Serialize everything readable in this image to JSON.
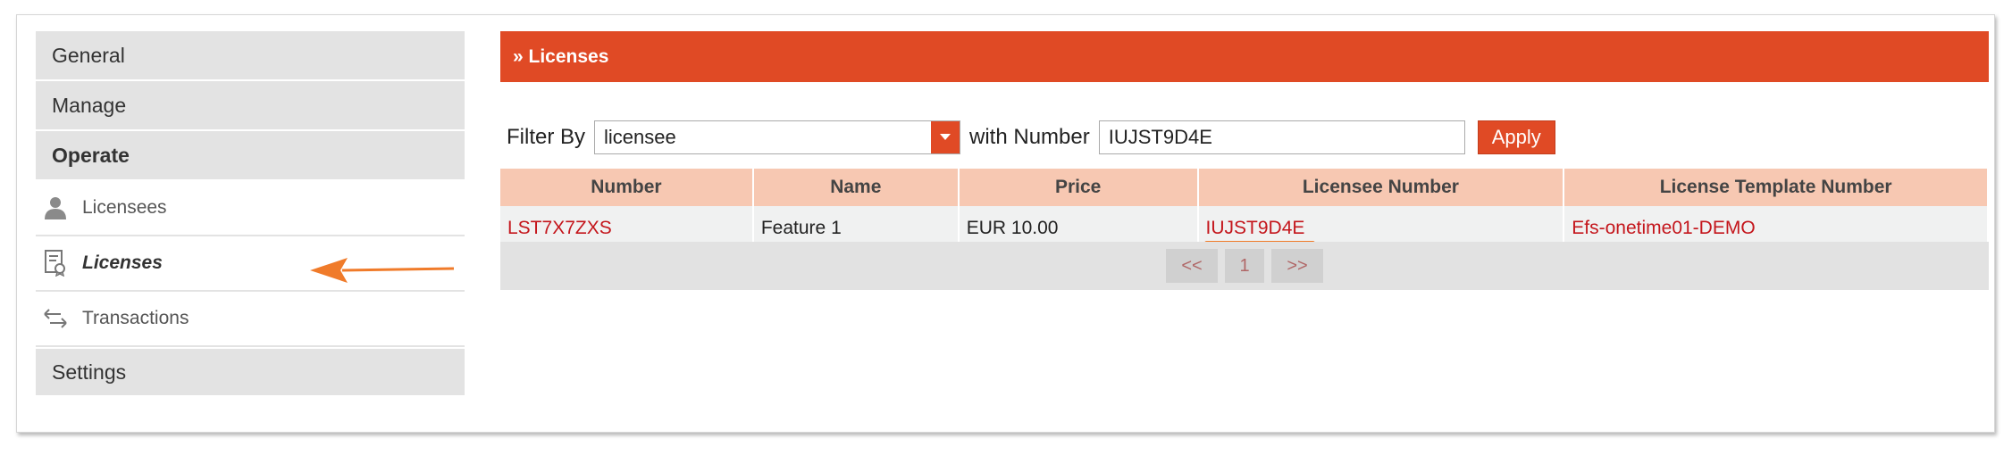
{
  "sidebar": {
    "general": "General",
    "manage": "Manage",
    "operate": "Operate",
    "items": [
      {
        "label": "Licensees",
        "icon": "person-icon"
      },
      {
        "label": "Licenses",
        "icon": "certificate-icon",
        "active": true
      },
      {
        "label": "Transactions",
        "icon": "transfer-icon"
      }
    ],
    "settings": "Settings"
  },
  "header": {
    "title": "» Licenses"
  },
  "filter": {
    "label": "Filter By",
    "select_value": "licensee",
    "with_number_label": "with Number",
    "number_value": "IUJST9D4E",
    "apply_label": "Apply"
  },
  "table": {
    "columns": [
      "Number",
      "Name",
      "Price",
      "Licensee Number",
      "License Template Number"
    ],
    "rows": [
      {
        "number": "LST7X7ZXS",
        "name": "Feature 1",
        "price": "EUR  10.00",
        "licensee_number": "IUJST9D4E",
        "template_number": "Efs-onetime01-DEMO"
      }
    ]
  },
  "pager": {
    "prev": "<<",
    "page": "1",
    "next": ">>"
  },
  "colors": {
    "accent": "#e04a25",
    "header_cell": "#f7c8b2",
    "link": "#c4161c",
    "arrow": "#f07b2a"
  }
}
